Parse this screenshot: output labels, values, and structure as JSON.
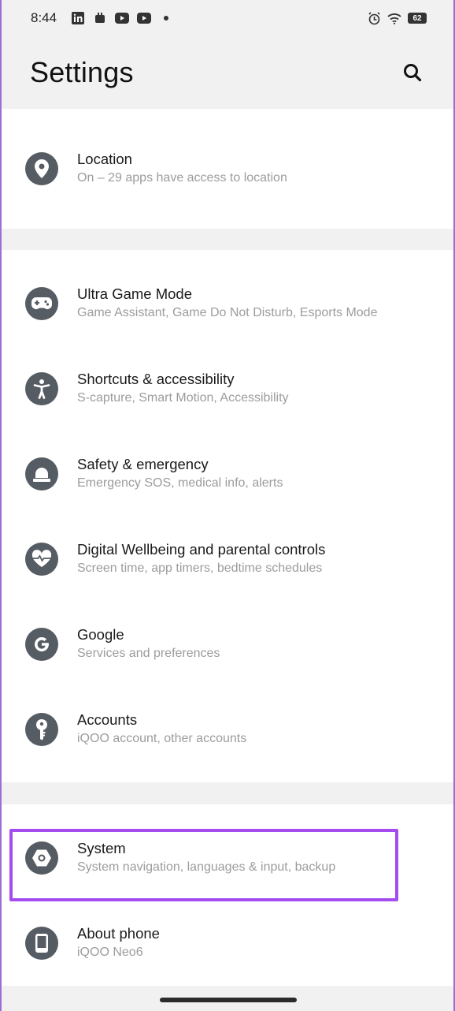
{
  "status_bar": {
    "time": "8:44",
    "battery": "62",
    "left_icons": [
      "linkedin-icon",
      "notification-app-icon",
      "youtube-icon",
      "youtube-icon",
      "more-dot-icon"
    ],
    "right_icons": [
      "alarm-icon",
      "wifi-icon",
      "battery-icon"
    ]
  },
  "header": {
    "title": "Settings",
    "search_icon": "search-icon"
  },
  "groups": [
    {
      "items": [
        {
          "id": "location",
          "icon": "location-pin-icon",
          "title": "Location",
          "subtitle": "On – 29 apps have access to location"
        }
      ]
    },
    {
      "items": [
        {
          "id": "ultra-game-mode",
          "icon": "gamepad-icon",
          "title": "Ultra Game Mode",
          "subtitle": "Game Assistant, Game Do Not Disturb, Esports Mode"
        },
        {
          "id": "shortcuts-accessibility",
          "icon": "accessibility-icon",
          "title": "Shortcuts & accessibility",
          "subtitle": "S-capture, Smart Motion, Accessibility"
        },
        {
          "id": "safety-emergency",
          "icon": "emergency-light-icon",
          "title": "Safety & emergency",
          "subtitle": "Emergency SOS, medical info, alerts"
        },
        {
          "id": "digital-wellbeing",
          "icon": "heart-icon",
          "title": "Digital Wellbeing and parental controls",
          "subtitle": "Screen time, app timers, bedtime schedules"
        },
        {
          "id": "google",
          "icon": "google-icon",
          "title": "Google",
          "subtitle": "Services and preferences"
        },
        {
          "id": "accounts",
          "icon": "key-icon",
          "title": "Accounts",
          "subtitle": "iQOO account, other accounts"
        }
      ]
    },
    {
      "items": [
        {
          "id": "system",
          "icon": "system-gear-icon",
          "title": "System",
          "subtitle": "System navigation, languages & input, backup"
        },
        {
          "id": "about-phone",
          "icon": "phone-icon",
          "title": "About phone",
          "subtitle": "iQOO Neo6"
        }
      ]
    }
  ],
  "colors": {
    "icon_bg": "#565c63",
    "highlight": "#a54cf0",
    "page_bg": "#f1f1f1"
  }
}
